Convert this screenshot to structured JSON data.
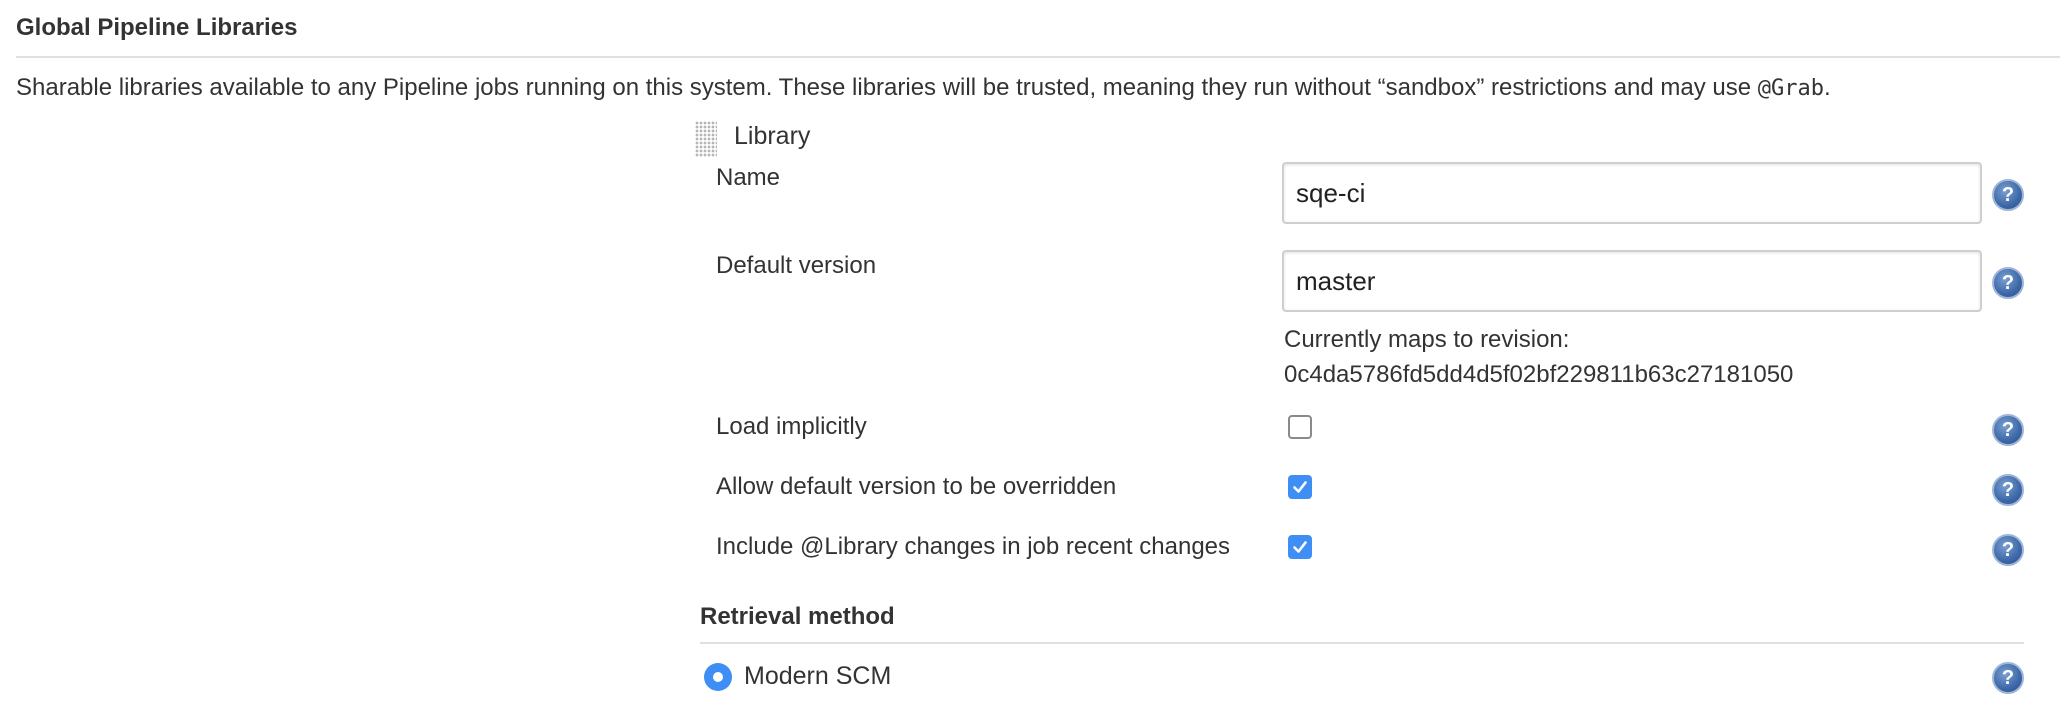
{
  "section": {
    "title": "Global Pipeline Libraries",
    "description_prefix": "Sharable libraries available to any Pipeline jobs running on this system. These libraries will be trusted, meaning they run without “sandbox” restrictions and may use ",
    "description_code": "@Grab",
    "description_suffix": "."
  },
  "library": {
    "title": "Library",
    "name": {
      "label": "Name",
      "value": "sqe-ci"
    },
    "default_version": {
      "label": "Default version",
      "value": "master"
    },
    "revision": {
      "label": "Currently maps to revision:",
      "hash": "0c4da5786fd5dd4d5f02bf229811b63c27181050"
    },
    "options": [
      {
        "label": "Load implicitly",
        "checked": false
      },
      {
        "label": "Allow default version to be overridden",
        "checked": true
      },
      {
        "label": "Include @Library changes in job recent changes",
        "checked": true
      }
    ]
  },
  "retrieval": {
    "title": "Retrieval method",
    "selected_option": "Modern SCM"
  },
  "icons": {
    "help": "help-icon",
    "drag": "drag-handle-icon",
    "check": "checkmark-icon"
  },
  "help_glyph": "?",
  "colors": {
    "accent": "#3e8ef5",
    "help_icon": "#3d68a8",
    "rule": "#e0e0e0",
    "text": "#333333"
  }
}
